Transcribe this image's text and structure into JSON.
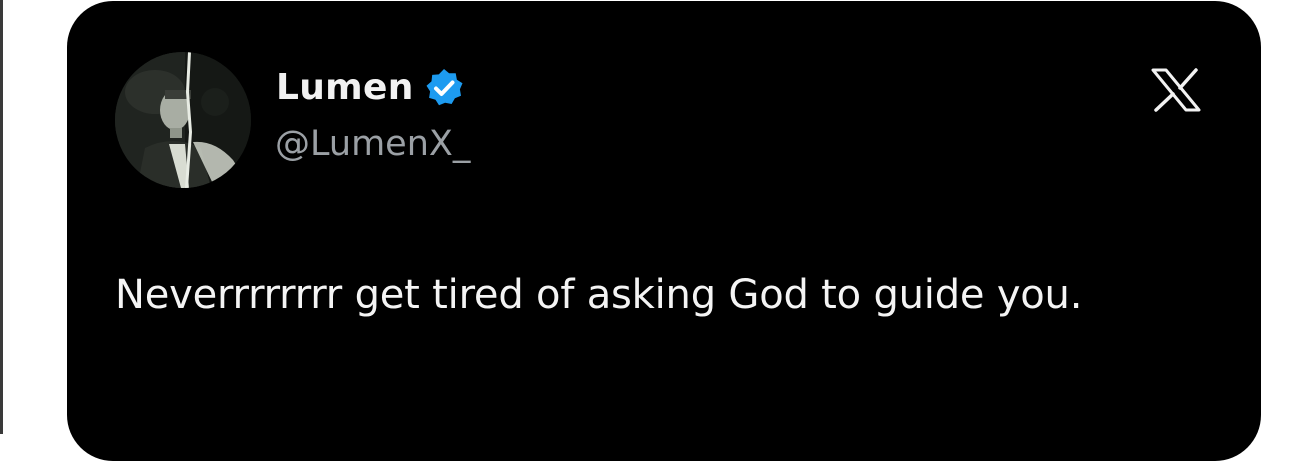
{
  "tweet": {
    "author": {
      "display_name": "Lumen",
      "handle": "@LumenX_",
      "verified": true,
      "avatar_icon": "person-portrait-avatar"
    },
    "text": "Neverrrrrrrr get tired of asking God to guide you."
  },
  "icons": {
    "platform_logo": "x-logo-icon",
    "verified": "verified-badge-icon"
  },
  "colors": {
    "card_background": "#000000",
    "text_primary": "#f4f4f4",
    "text_secondary": "#9ba0a5",
    "verified_badge": "#1d9bf0"
  }
}
